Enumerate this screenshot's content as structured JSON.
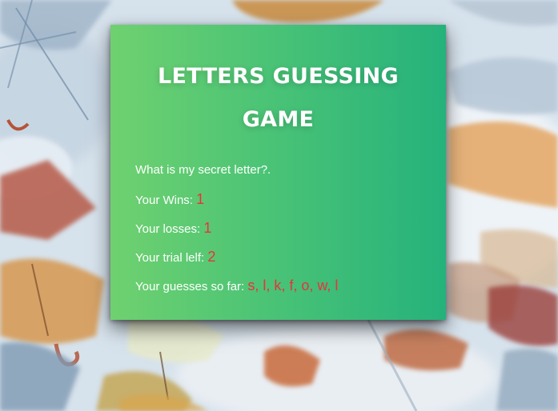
{
  "game": {
    "title": "LETTERS GUESSING GAME",
    "prompt": "What is my secret letter?.",
    "wins_label": "Your Wins:",
    "wins_value": "1",
    "losses_label": "Your losses:",
    "losses_value": "1",
    "trials_label": "Your trial lelf:",
    "trials_value": "2",
    "guesses_label": "Your guesses so far:",
    "guesses_value": "s, l, k, f, o, w, l"
  },
  "colors": {
    "card_gradient_start": "#6fd16f",
    "card_gradient_end": "#25b27b",
    "value_text": "#e8333a",
    "label_text": "#ffffff"
  },
  "background": {
    "description_icon": "umbrellas-photo-background"
  }
}
